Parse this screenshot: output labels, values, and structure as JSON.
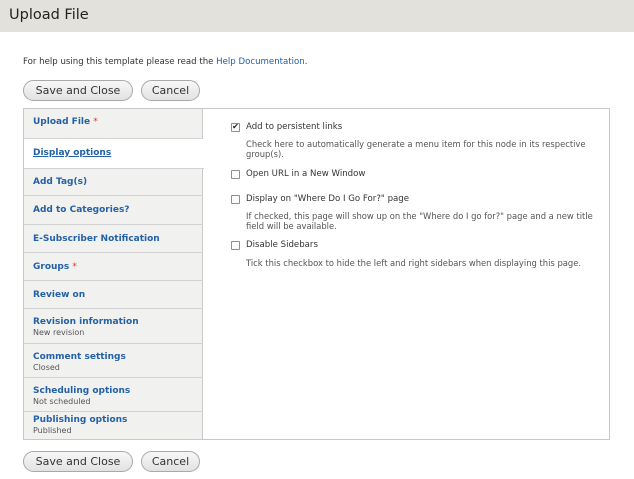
{
  "page": {
    "title": "Upload File"
  },
  "help": {
    "prefix": "For help using this template please read the ",
    "link": "Help Documentation",
    "suffix": "."
  },
  "actions": {
    "save_label": "Save and Close",
    "cancel_label": "Cancel"
  },
  "tabs": [
    {
      "label": "Upload File",
      "required": "*",
      "summary": ""
    },
    {
      "label": "Display options",
      "required": "",
      "summary": ""
    },
    {
      "label": "Add Tag(s)",
      "required": "",
      "summary": ""
    },
    {
      "label": "Add to Categories?",
      "required": "",
      "summary": ""
    },
    {
      "label": "E-Subscriber Notification",
      "required": "",
      "summary": ""
    },
    {
      "label": "Groups",
      "required": "*",
      "summary": ""
    },
    {
      "label": "Review on",
      "required": "",
      "summary": ""
    },
    {
      "label": "Revision information",
      "required": "",
      "summary": "New revision"
    },
    {
      "label": "Comment settings",
      "required": "",
      "summary": "Closed"
    },
    {
      "label": "Scheduling options",
      "required": "",
      "summary": "Not scheduled"
    },
    {
      "label": "Publishing options",
      "required": "",
      "summary": "Published"
    }
  ],
  "active_tab": "Display options",
  "options": [
    {
      "label": "Add to persistent links",
      "checked": true,
      "check_glyph": "✔",
      "description": "Check here to automatically generate a menu item for this node in its respective group(s)."
    },
    {
      "label": "Open URL in a New Window",
      "checked": false,
      "check_glyph": "",
      "description": ""
    },
    {
      "label": "Display on \"Where Do I Go For?\" page",
      "checked": false,
      "check_glyph": "",
      "description": "If checked, this page will show up on the \"Where do I go for?\" page and a new title field will be available."
    },
    {
      "label": "Disable Sidebars",
      "checked": false,
      "check_glyph": "",
      "description": "Tick this checkbox to hide the left and right sidebars when displaying this page."
    }
  ]
}
